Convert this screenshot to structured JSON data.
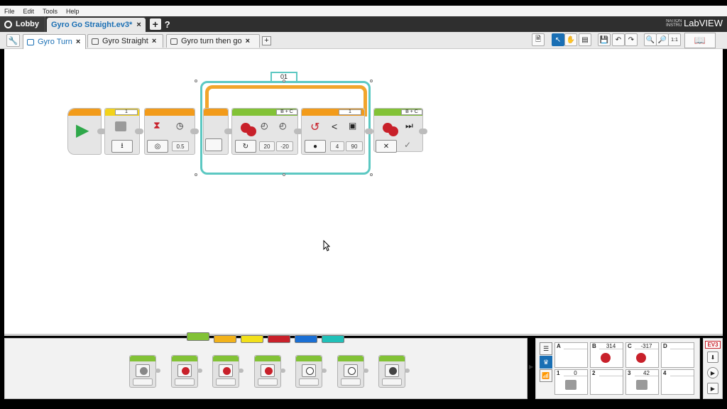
{
  "menu": [
    "File",
    "Edit",
    "Tools",
    "Help"
  ],
  "project": {
    "lobby_label": "Lobby",
    "tab_label": "Gyro Go Straight.ev3*",
    "close": "×",
    "add": "+",
    "help": "?",
    "brand": "LabVIEW",
    "brand_small": "NATIONAL INSTRUMENTS"
  },
  "program_tabs": [
    {
      "label": "Gyro Turn",
      "active": true
    },
    {
      "label": "Gyro Straight",
      "active": false
    },
    {
      "label": "Gyro turn then go",
      "active": false
    }
  ],
  "program_add": "+",
  "blocks": {
    "sensor_port": "1",
    "wait_value": "0.5",
    "loop_name": "01",
    "steer_ports": "B + C",
    "steer_left": "20",
    "steer_right": "-20",
    "compare_port": "1",
    "compare_op": "<",
    "compare_threshold": "4",
    "compare_value": "90",
    "stop_ports": "B + C"
  },
  "palette_colors": [
    "#82c236",
    "#f2b21a",
    "#f2e01a",
    "#c8202a",
    "#1a6fd4",
    "#20c0b8"
  ],
  "hardware": {
    "ports_top": [
      {
        "name": "A",
        "value": ""
      },
      {
        "name": "B",
        "value": "314"
      },
      {
        "name": "C",
        "value": "-317"
      },
      {
        "name": "D",
        "value": ""
      }
    ],
    "ports_bottom": [
      {
        "name": "1",
        "value": "0"
      },
      {
        "name": "2",
        "value": ""
      },
      {
        "name": "3",
        "value": "42"
      },
      {
        "name": "4",
        "value": ""
      }
    ]
  },
  "ev3_label": "EV3"
}
